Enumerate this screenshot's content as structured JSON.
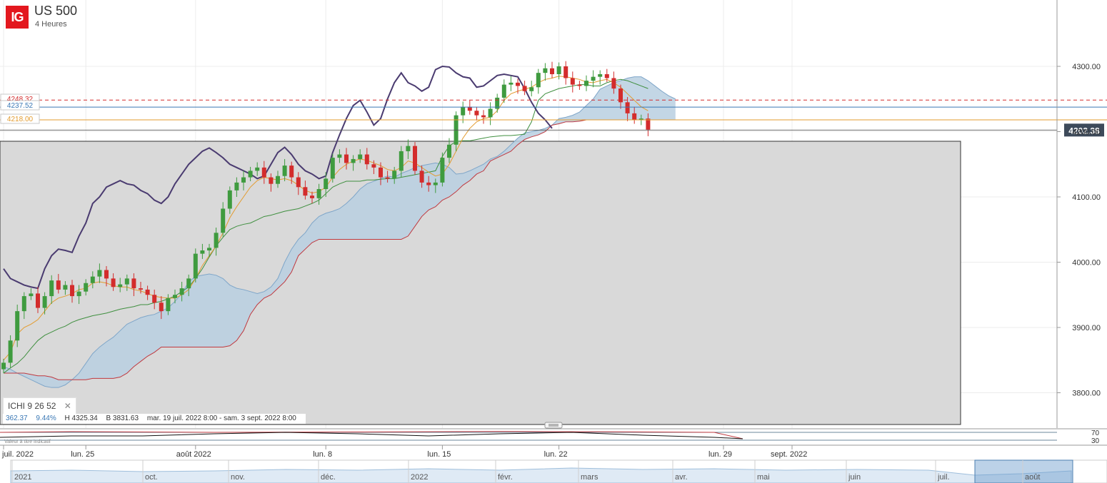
{
  "instrument": {
    "logo": "IG",
    "name": "US 500",
    "timeframe": "4 Heures"
  },
  "indicator": {
    "name": "ICHI",
    "params": [
      "9",
      "26",
      "52"
    ],
    "close_icon": "close-icon"
  },
  "stats": {
    "range": "362.37",
    "pct": "9.44%",
    "high": "H 4325.34",
    "low": "B 3831.63",
    "period": "mar. 19 juil. 2022 8:00 - sam. 3 sept. 2022 8:00"
  },
  "disclaimer": "Valeur à titre indicatif",
  "colors": {
    "up": "#3f9b3f",
    "down": "#d32c2c",
    "cloud": "#b8cfe1",
    "cloud_dark": "#8ea9c4",
    "price_line": "#4a3b70",
    "tenkan": "#e39b2e",
    "kijun": "#3f8f3f",
    "senkou_b": "#c0393f",
    "accent": "#3a78b5"
  },
  "chart_data": {
    "type": "candlestick",
    "y_ticks": [
      "4300.00",
      "4200.00",
      "4100.00",
      "4000.00",
      "3900.00",
      "3800.00"
    ],
    "ylim": [
      3750,
      4345
    ],
    "x_labels": [
      {
        "label": "juil. 2022",
        "x": 0
      },
      {
        "label": "lun. 25",
        "x": 12
      },
      {
        "label": "août 2022",
        "x": 28
      },
      {
        "label": "lun. 8",
        "x": 47
      },
      {
        "label": "lun. 15",
        "x": 64
      },
      {
        "label": "lun. 22",
        "x": 81
      },
      {
        "label": "lun. 29",
        "x": 105
      },
      {
        "label": "sept. 2022",
        "x": 115
      }
    ],
    "current_price": "4202.38",
    "price_tags": [
      {
        "label": "4248.32",
        "value": 4248.32,
        "color": "#d32c2c",
        "style": "dashed"
      },
      {
        "label": "4237.52",
        "value": 4237.52,
        "color": "#3a78b5",
        "style": "solid"
      },
      {
        "label": "4218.00",
        "value": 4218.0,
        "color": "#e39b2e",
        "style": "solid"
      }
    ],
    "closes": [
      3846,
      3880,
      3925,
      3948,
      3952,
      3930,
      3948,
      3972,
      3958,
      3965,
      3948,
      3955,
      3968,
      3978,
      3988,
      3975,
      3962,
      3966,
      3975,
      3960,
      3958,
      3950,
      3938,
      3925,
      3945,
      3950,
      3960,
      3975,
      4013,
      4018,
      4022,
      4045,
      4082,
      4110,
      4122,
      4130,
      4140,
      4145,
      4130,
      4120,
      4132,
      4148,
      4130,
      4115,
      4102,
      4098,
      4112,
      4128,
      4160,
      4165,
      4152,
      4158,
      4165,
      4150,
      4145,
      4130,
      4128,
      4140,
      4170,
      4178,
      4140,
      4122,
      4118,
      4122,
      4160,
      4180,
      4225,
      4238,
      4232,
      4225,
      4222,
      4235,
      4252,
      4272,
      4275,
      4270,
      4262,
      4268,
      4290,
      4297,
      4288,
      4300,
      4282,
      4272,
      4270,
      4278,
      4284,
      4288,
      4282,
      4266,
      4245,
      4228,
      4218,
      4220,
      4203
    ],
    "chikou": [
      3990,
      3975,
      3970,
      3965,
      3962,
      3960,
      3990,
      4010,
      4020,
      4018,
      4015,
      4040,
      4060,
      4090,
      4100,
      4115,
      4120,
      4125,
      4120,
      4118,
      4110,
      4105,
      4095,
      4090,
      4100,
      4120,
      4135,
      4150,
      4160,
      4170,
      4175,
      4168,
      4160,
      4150,
      4145,
      4140,
      4135,
      4128,
      4132,
      4150,
      4168,
      4176,
      4165,
      4150,
      4140,
      4135,
      4128,
      4132,
      4168,
      4195,
      4220,
      4240,
      4248,
      4230,
      4210,
      4220,
      4250,
      4275,
      4290,
      4275,
      4270,
      4262,
      4268,
      4295,
      4300,
      4299,
      4290,
      4284,
      4282,
      4268,
      4270,
      4278,
      4286,
      4288,
      4286,
      4284,
      4266,
      4245,
      4228,
      4218,
      4205
    ],
    "tenkan_sen": [
      3850,
      3862,
      3890,
      3900,
      3905,
      3912,
      3925,
      3938,
      3945,
      3948,
      3952,
      3958,
      3960,
      3968,
      3970,
      3968,
      3964,
      3962,
      3962,
      3958,
      3956,
      3952,
      3948,
      3946,
      3945,
      3945,
      3950,
      3958,
      3975,
      3995,
      4010,
      4025,
      4045,
      4068,
      4085,
      4100,
      4115,
      4125,
      4130,
      4128,
      4126,
      4128,
      4125,
      4118,
      4110,
      4106,
      4108,
      4115,
      4130,
      4142,
      4150,
      4155,
      4158,
      4156,
      4152,
      4148,
      4142,
      4140,
      4145,
      4155,
      4152,
      4145,
      4138,
      4132,
      4135,
      4150,
      4170,
      4190,
      4205,
      4215,
      4220,
      4222,
      4232,
      4248,
      4258,
      4262,
      4265,
      4268,
      4275,
      4280,
      4282,
      4285,
      4284,
      4282,
      4280,
      4276,
      4275,
      4278,
      4280,
      4275,
      4268,
      4258,
      4248,
      4238,
      4232
    ],
    "kijun_sen": [
      3830,
      3838,
      3845,
      3855,
      3868,
      3880,
      3888,
      3893,
      3898,
      3902,
      3908,
      3912,
      3915,
      3918,
      3920,
      3922,
      3925,
      3928,
      3930,
      3932,
      3935,
      3935,
      3938,
      3940,
      3944,
      3948,
      3955,
      3962,
      3975,
      3990,
      4008,
      4025,
      4038,
      4050,
      4055,
      4058,
      4060,
      4065,
      4070,
      4072,
      4075,
      4078,
      4080,
      4082,
      4086,
      4090,
      4095,
      4105,
      4115,
      4120,
      4124,
      4124,
      4124,
      4126,
      4126,
      4127,
      4128,
      4128,
      4130,
      4132,
      4134,
      4136,
      4138,
      4140,
      4162,
      4178,
      4185,
      4186,
      4186,
      4188,
      4190,
      4192,
      4193,
      4194,
      4194,
      4195,
      4196,
      4215,
      4248,
      4258,
      4262,
      4266,
      4268,
      4270,
      4272,
      4272,
      4270,
      4270,
      4275,
      4278,
      4280,
      4278,
      4274,
      4270,
      4266
    ],
    "senkou_a": [
      3840,
      3836,
      3830,
      3825,
      3820,
      3815,
      3810,
      3808,
      3808,
      3812,
      3820,
      3830,
      3845,
      3860,
      3870,
      3878,
      3885,
      3895,
      3905,
      3910,
      3915,
      3918,
      3920,
      3925,
      3930,
      3940,
      3952,
      3970,
      3978,
      3980,
      3982,
      3980,
      3975,
      3965,
      3960,
      3958,
      3955,
      3952,
      3955,
      3962,
      3975,
      4000,
      4020,
      4035,
      4045,
      4060,
      4070,
      4075,
      4078,
      4082,
      4090,
      4100,
      4112,
      4120,
      4124,
      4128,
      4132,
      4130,
      4136,
      4140,
      4145,
      4148,
      4150,
      4152,
      4150,
      4145,
      4135,
      4136,
      4140,
      4145,
      4150,
      4158,
      4162,
      4170,
      4180,
      4190,
      4198,
      4200,
      4202,
      4205,
      4210,
      4220,
      4222,
      4225,
      4230,
      4240,
      4250,
      4265,
      4270,
      4275,
      4278,
      4282,
      4284,
      4284,
      4278,
      4270,
      4262,
      4255,
      4250
    ],
    "senkou_b": [
      3830,
      3830,
      3830,
      3830,
      3828,
      3826,
      3826,
      3824,
      3820,
      3820,
      3820,
      3820,
      3820,
      3822,
      3822,
      3822,
      3822,
      3824,
      3830,
      3840,
      3848,
      3856,
      3862,
      3870,
      3870,
      3870,
      3870,
      3870,
      3870,
      3870,
      3870,
      3870,
      3870,
      3872,
      3880,
      3895,
      3920,
      3935,
      3945,
      3950,
      3960,
      3970,
      3985,
      4010,
      4020,
      4030,
      4035,
      4035,
      4035,
      4035,
      4035,
      4035,
      4035,
      4035,
      4035,
      4035,
      4035,
      4035,
      4035,
      4040,
      4055,
      4070,
      4080,
      4085,
      4095,
      4100,
      4108,
      4118,
      4125,
      4135,
      4140,
      4155,
      4160,
      4165,
      4170,
      4180,
      4188,
      4192,
      4195,
      4200,
      4210,
      4212,
      4215,
      4215,
      4216,
      4218,
      4218,
      4218,
      4218,
      4218,
      4218,
      4218,
      4218,
      4218,
      4218,
      4218,
      4218,
      4218,
      4218
    ]
  }
}
